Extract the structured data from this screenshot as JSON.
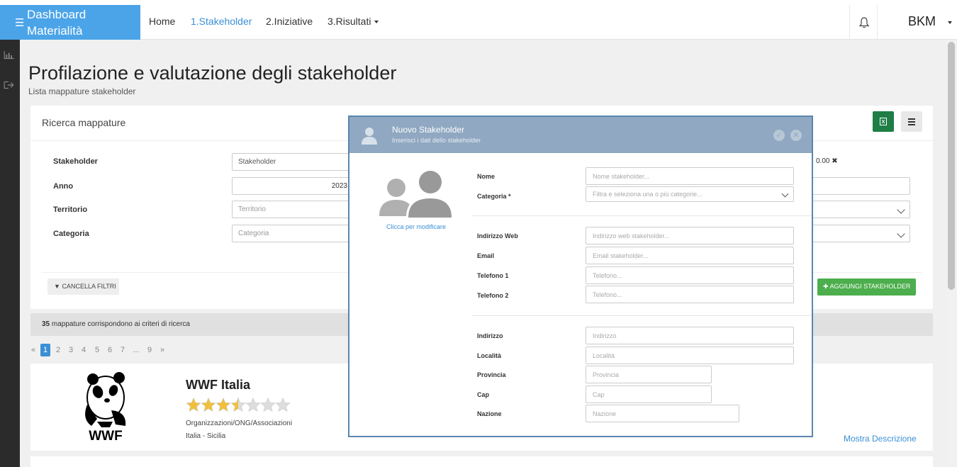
{
  "app": {
    "title": "Dashboard Materialità",
    "user": "BKM"
  },
  "nav": {
    "home": "Home",
    "stakeholder": "1.Stakeholder",
    "iniziative": "2.Iniziative",
    "risultati": "3.Risultati"
  },
  "page": {
    "title": "Profilazione e valutazione degli stakeholder",
    "subtitle": "Lista mappature stakeholder"
  },
  "search_panel": {
    "title": "Ricerca mappature",
    "stakeholder_label": "Stakeholder",
    "stakeholder_placeholder": "Stakeholder",
    "anno_label": "Anno",
    "anno_value": "2023",
    "territorio_label": "Territorio",
    "territorio_placeholder": "Territorio",
    "categoria_label": "Categoria",
    "categoria_placeholder": "Categoria",
    "range_value": "0.00",
    "clear_filters": "CANCELLA FILTRI",
    "add_stakeholder": "AGGIUNGI STAKEHOLDER"
  },
  "results": {
    "count": "35",
    "text": "mappature corrispondono ai criteri di ricerca"
  },
  "pagination": {
    "prev": "«",
    "pages": [
      "1",
      "2",
      "3",
      "4",
      "5",
      "6",
      "7",
      "...",
      "9"
    ],
    "next": "»",
    "active": "1"
  },
  "card": {
    "name": "WWF Italia",
    "rating": 3.5,
    "rating_max": 7,
    "category": "Organizzazioni/ONG/Associazioni",
    "location": "Italia - Sicilia",
    "logo_text": "WWF",
    "more_link": "Mostra Descrizione"
  },
  "modal": {
    "title": "Nuovo Stakeholder",
    "subtitle": "Inserisci i dati dello stakeholder",
    "avatar_link": "Clicca per modificare",
    "fields": {
      "nome_label": "Nome",
      "nome_placeholder": "Nome stakeholder...",
      "categoria_label": "Categoria *",
      "categoria_placeholder": "Filtra e seleziona una o più categorie...",
      "web_label": "Indirizzo Web",
      "web_placeholder": "Indirizzo web stakeholder...",
      "email_label": "Email",
      "email_placeholder": "Email stakeholder...",
      "tel1_label": "Telefono 1",
      "tel1_placeholder": "Telefono...",
      "tel2_label": "Telefono 2",
      "tel2_placeholder": "Telefono...",
      "indirizzo_label": "Indirizzo",
      "indirizzo_placeholder": "Indirizzo",
      "localita_label": "Località",
      "localita_placeholder": "Località",
      "provincia_label": "Provincia",
      "provincia_placeholder": "Provincia",
      "cap_label": "Cap",
      "cap_placeholder": "Cap",
      "nazione_label": "Nazione",
      "nazione_placeholder": "Nazione"
    }
  },
  "colors": {
    "brand": "#4ba4e8",
    "link": "#3a8fd5",
    "success": "#4cae4c",
    "excel": "#1e7e45",
    "modal_header": "#90a8c1",
    "star": "#f0c03c"
  }
}
